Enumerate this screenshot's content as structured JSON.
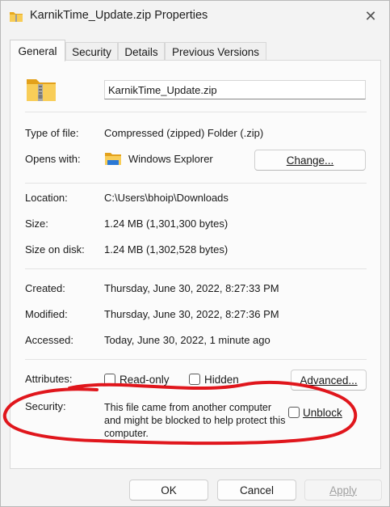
{
  "window": {
    "title": "KarnikTime_Update.zip Properties",
    "close_glyph": "✕"
  },
  "tabs": [
    {
      "label": "General",
      "active": true
    },
    {
      "label": "Security",
      "active": false
    },
    {
      "label": "Details",
      "active": false
    },
    {
      "label": "Previous Versions",
      "active": false
    }
  ],
  "general": {
    "file_name": "KarnikTime_Update.zip",
    "type_label": "Type of file:",
    "type_value": "Compressed (zipped) Folder (.zip)",
    "opens_label": "Opens with:",
    "opens_value": "Windows Explorer",
    "change_button": "Change...",
    "location_label": "Location:",
    "location_value": "C:\\Users\\bhoip\\Downloads",
    "size_label": "Size:",
    "size_value": "1.24 MB (1,301,300 bytes)",
    "size_on_disk_label": "Size on disk:",
    "size_on_disk_value": "1.24 MB (1,302,528 bytes)",
    "created_label": "Created:",
    "created_value": "Thursday, June 30, 2022, 8:27:33 PM",
    "modified_label": "Modified:",
    "modified_value": "Thursday, June 30, 2022, 8:27:36 PM",
    "accessed_label": "Accessed:",
    "accessed_value": "Today, June 30, 2022, 1 minute ago",
    "attributes_label": "Attributes:",
    "readonly_label": "Read-only",
    "readonly_checked": false,
    "hidden_label": "Hidden",
    "hidden_checked": false,
    "advanced_button": "Advanced...",
    "security_label": "Security:",
    "security_text": "This file came from another computer and might be blocked to help protect this computer.",
    "unblock_label": "Unblock",
    "unblock_checked": false
  },
  "footer": {
    "ok": "OK",
    "cancel": "Cancel",
    "apply": "Apply"
  },
  "colors": {
    "annotation_red": "#e0161c",
    "folder_yellow": "#f4c542",
    "window_bg": "#f3f3f3",
    "panel_bg": "#fbfbfb"
  },
  "icons": {
    "title": "zip-folder-icon",
    "file": "zip-folder-icon",
    "opens_with": "file-explorer-icon"
  }
}
